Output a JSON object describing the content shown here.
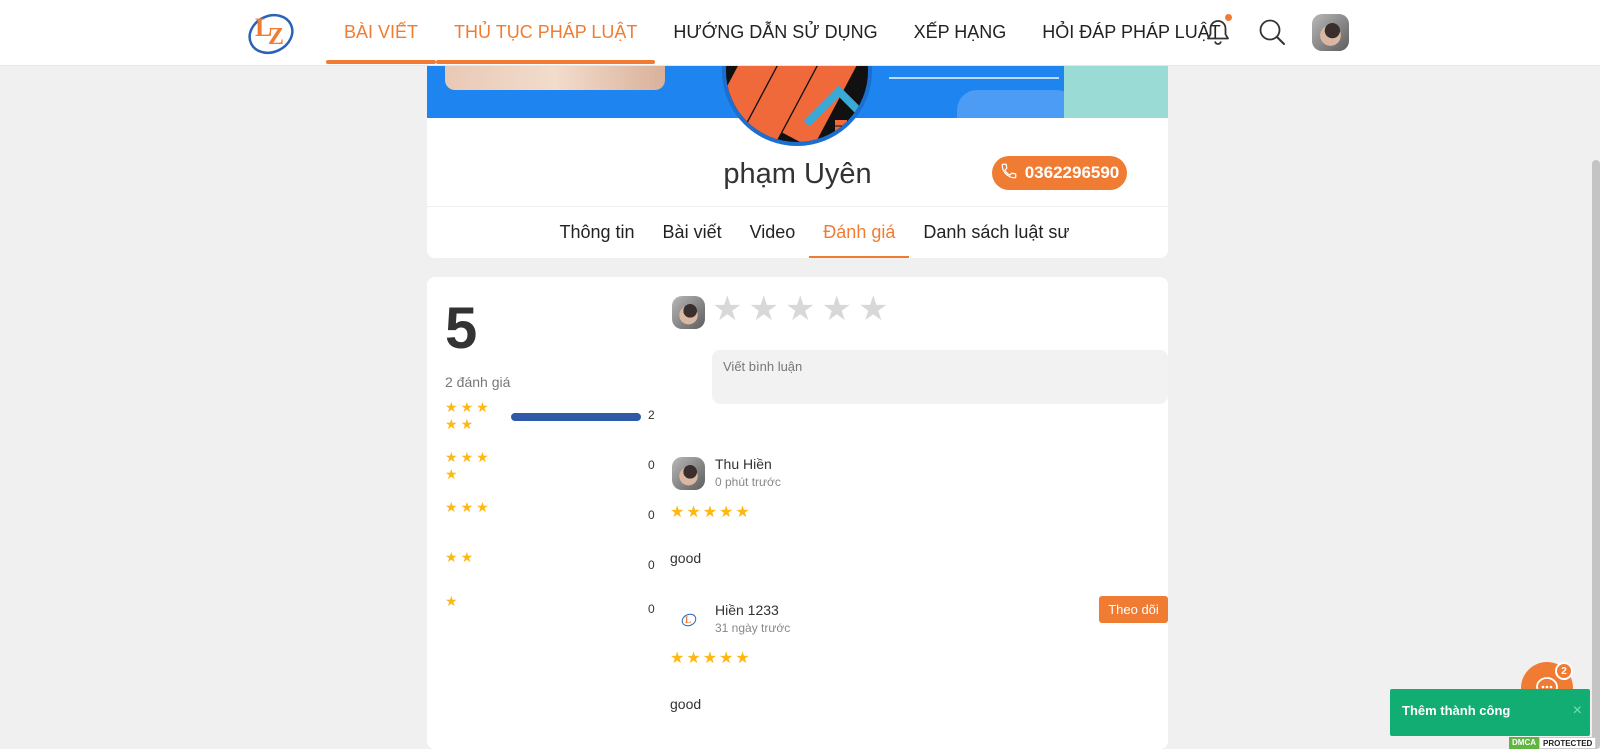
{
  "header": {
    "nav": [
      {
        "label": "BÀI VIẾT",
        "active": true
      },
      {
        "label": "THỦ TỤC PHÁP LUẬT",
        "active": true
      },
      {
        "label": "HƯỚNG DẪN SỬ DỤNG",
        "active": false
      },
      {
        "label": "XẾP HẠNG",
        "active": false
      },
      {
        "label": "HỎI ĐÁP PHÁP LUẬT",
        "active": false
      }
    ],
    "icons": [
      "bell-icon",
      "search-icon",
      "user-avatar"
    ]
  },
  "profile": {
    "name": "phạm Uyên",
    "phone": "0362296590",
    "tabs": [
      {
        "label": "Thông tin",
        "active": false
      },
      {
        "label": "Bài viết",
        "active": false
      },
      {
        "label": "Video",
        "active": false
      },
      {
        "label": "Đánh giá",
        "active": true
      },
      {
        "label": "Danh sách luật sư",
        "active": false
      }
    ]
  },
  "ratings": {
    "average": "5",
    "count_label": "2 đánh giá",
    "distribution": [
      {
        "stars": 5,
        "count": "2",
        "fraction": 1.0
      },
      {
        "stars": 4,
        "count": "0",
        "fraction": 0
      },
      {
        "stars": 3,
        "count": "0",
        "fraction": 0
      },
      {
        "stars": 2,
        "count": "0",
        "fraction": 0
      },
      {
        "stars": 1,
        "count": "0",
        "fraction": 0
      }
    ],
    "comment_placeholder": "Viết bình luận",
    "reviews": [
      {
        "name": "Thu Hiền",
        "time": "0 phút trước",
        "stars": 5,
        "text": "good",
        "follow": ""
      },
      {
        "name": "Hiền 1233",
        "time": "31 ngày trước",
        "stars": 5,
        "text": "good",
        "follow": "Theo dõi"
      }
    ]
  },
  "chat": {
    "badge": "2"
  },
  "toast": {
    "text": "Thêm thành công",
    "close": "×"
  },
  "dmca": {
    "left": "DMCA",
    "right": "PROTECTED"
  },
  "colors": {
    "accent": "#f07c33",
    "star": "#fdb813",
    "bar": "#2f5aa8",
    "toast": "#12ad73"
  }
}
